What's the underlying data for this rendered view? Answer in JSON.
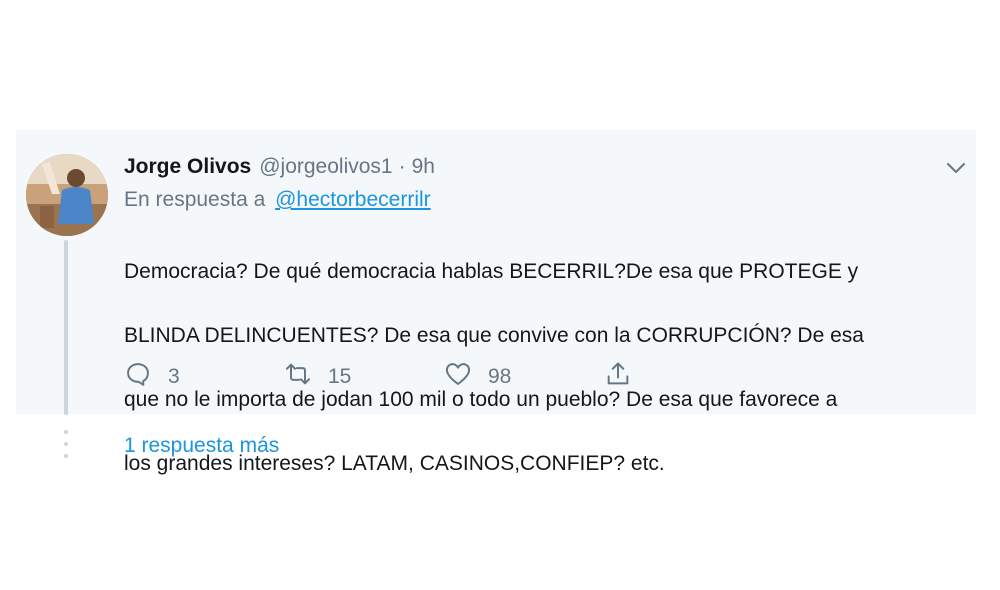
{
  "tweet": {
    "author_name": "Jorge Olivos",
    "author_handle": "@jorgeolivos1",
    "separator": "·",
    "time": "9h",
    "reply_prefix": "En respuesta a",
    "reply_handle": "@hectorbecerrilr",
    "text_lines": [
      "Democracia? De qué democracia hablas BECERRIL?De esa que PROTEGE y",
      "BLINDA DELINCUENTES? De esa que convive con la CORRUPCIÓN? De esa",
      "que no le importa de jodan 100 mil o todo un pueblo? De esa que favorece a",
      "los grandes intereses? LATAM, CASINOS,CONFIEP? etc."
    ],
    "actions": {
      "reply_count": "3",
      "retweet_count": "15",
      "like_count": "98"
    }
  },
  "thread": {
    "more_replies_label": "1 respuesta más"
  },
  "icons": {
    "reply": "comment-icon",
    "retweet": "retweet-icon",
    "like": "heart-icon",
    "share": "share-icon",
    "menu": "chevron-down-icon"
  },
  "colors": {
    "link": "#1b95e0",
    "muted": "#657786",
    "text": "#14171a",
    "card_bg": "#f5f8fa"
  }
}
